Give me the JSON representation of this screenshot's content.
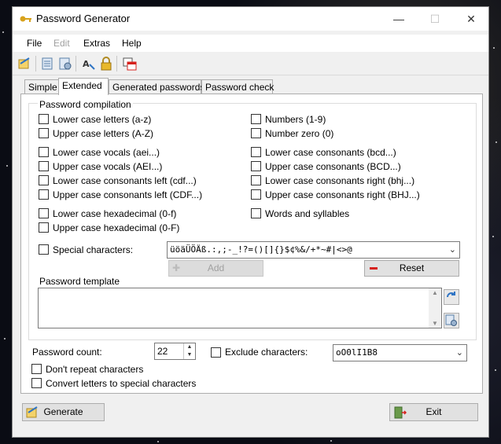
{
  "window": {
    "title": "Password Generator",
    "minimize": "—",
    "maximize": "☐",
    "close": "✕"
  },
  "menu": [
    "File",
    "Edit",
    "Extras",
    "Help"
  ],
  "tabs": [
    "Simple",
    "Extended",
    "Generated passwords",
    "Password check"
  ],
  "compilation": {
    "title": "Password compilation",
    "left": [
      "Lower case letters (a-z)",
      "Upper case letters (A-Z)",
      "Lower case vocals (aei...)",
      "Upper case vocals (AEI...)",
      "Lower case consonants left (cdf...)",
      "Upper case consonants left (CDF...)",
      "Lower case hexadecimal (0-f)",
      "Upper case hexadecimal (0-F)"
    ],
    "right": [
      "Numbers (1-9)",
      "Number zero (0)",
      "Lower case consonants (bcd...)",
      "Upper case consonants (BCD...)",
      "Lower case consonants right (bhj...)",
      "Upper case consonants right (BHJ...)",
      "Words and syllables"
    ],
    "special_label": "Special characters:",
    "special_value": "üöäÜÖÄß.:,;-_!?=()[]{}$¢%&/+*~#|<>@",
    "add_button": "Add",
    "reset_button": "Reset",
    "template_label": "Password template"
  },
  "bottom": {
    "count_label": "Password count:",
    "count_value": "22",
    "exclude_label": "Exclude characters:",
    "exclude_value": "oO0lI1B8",
    "dont_repeat": "Don't repeat characters",
    "convert": "Convert letters to special characters"
  },
  "buttons": {
    "generate": "Generate",
    "exit": "Exit"
  },
  "colors": {
    "accent_red": "#d6201c",
    "gold": "#d8a21c",
    "blue": "#2f74c4"
  }
}
